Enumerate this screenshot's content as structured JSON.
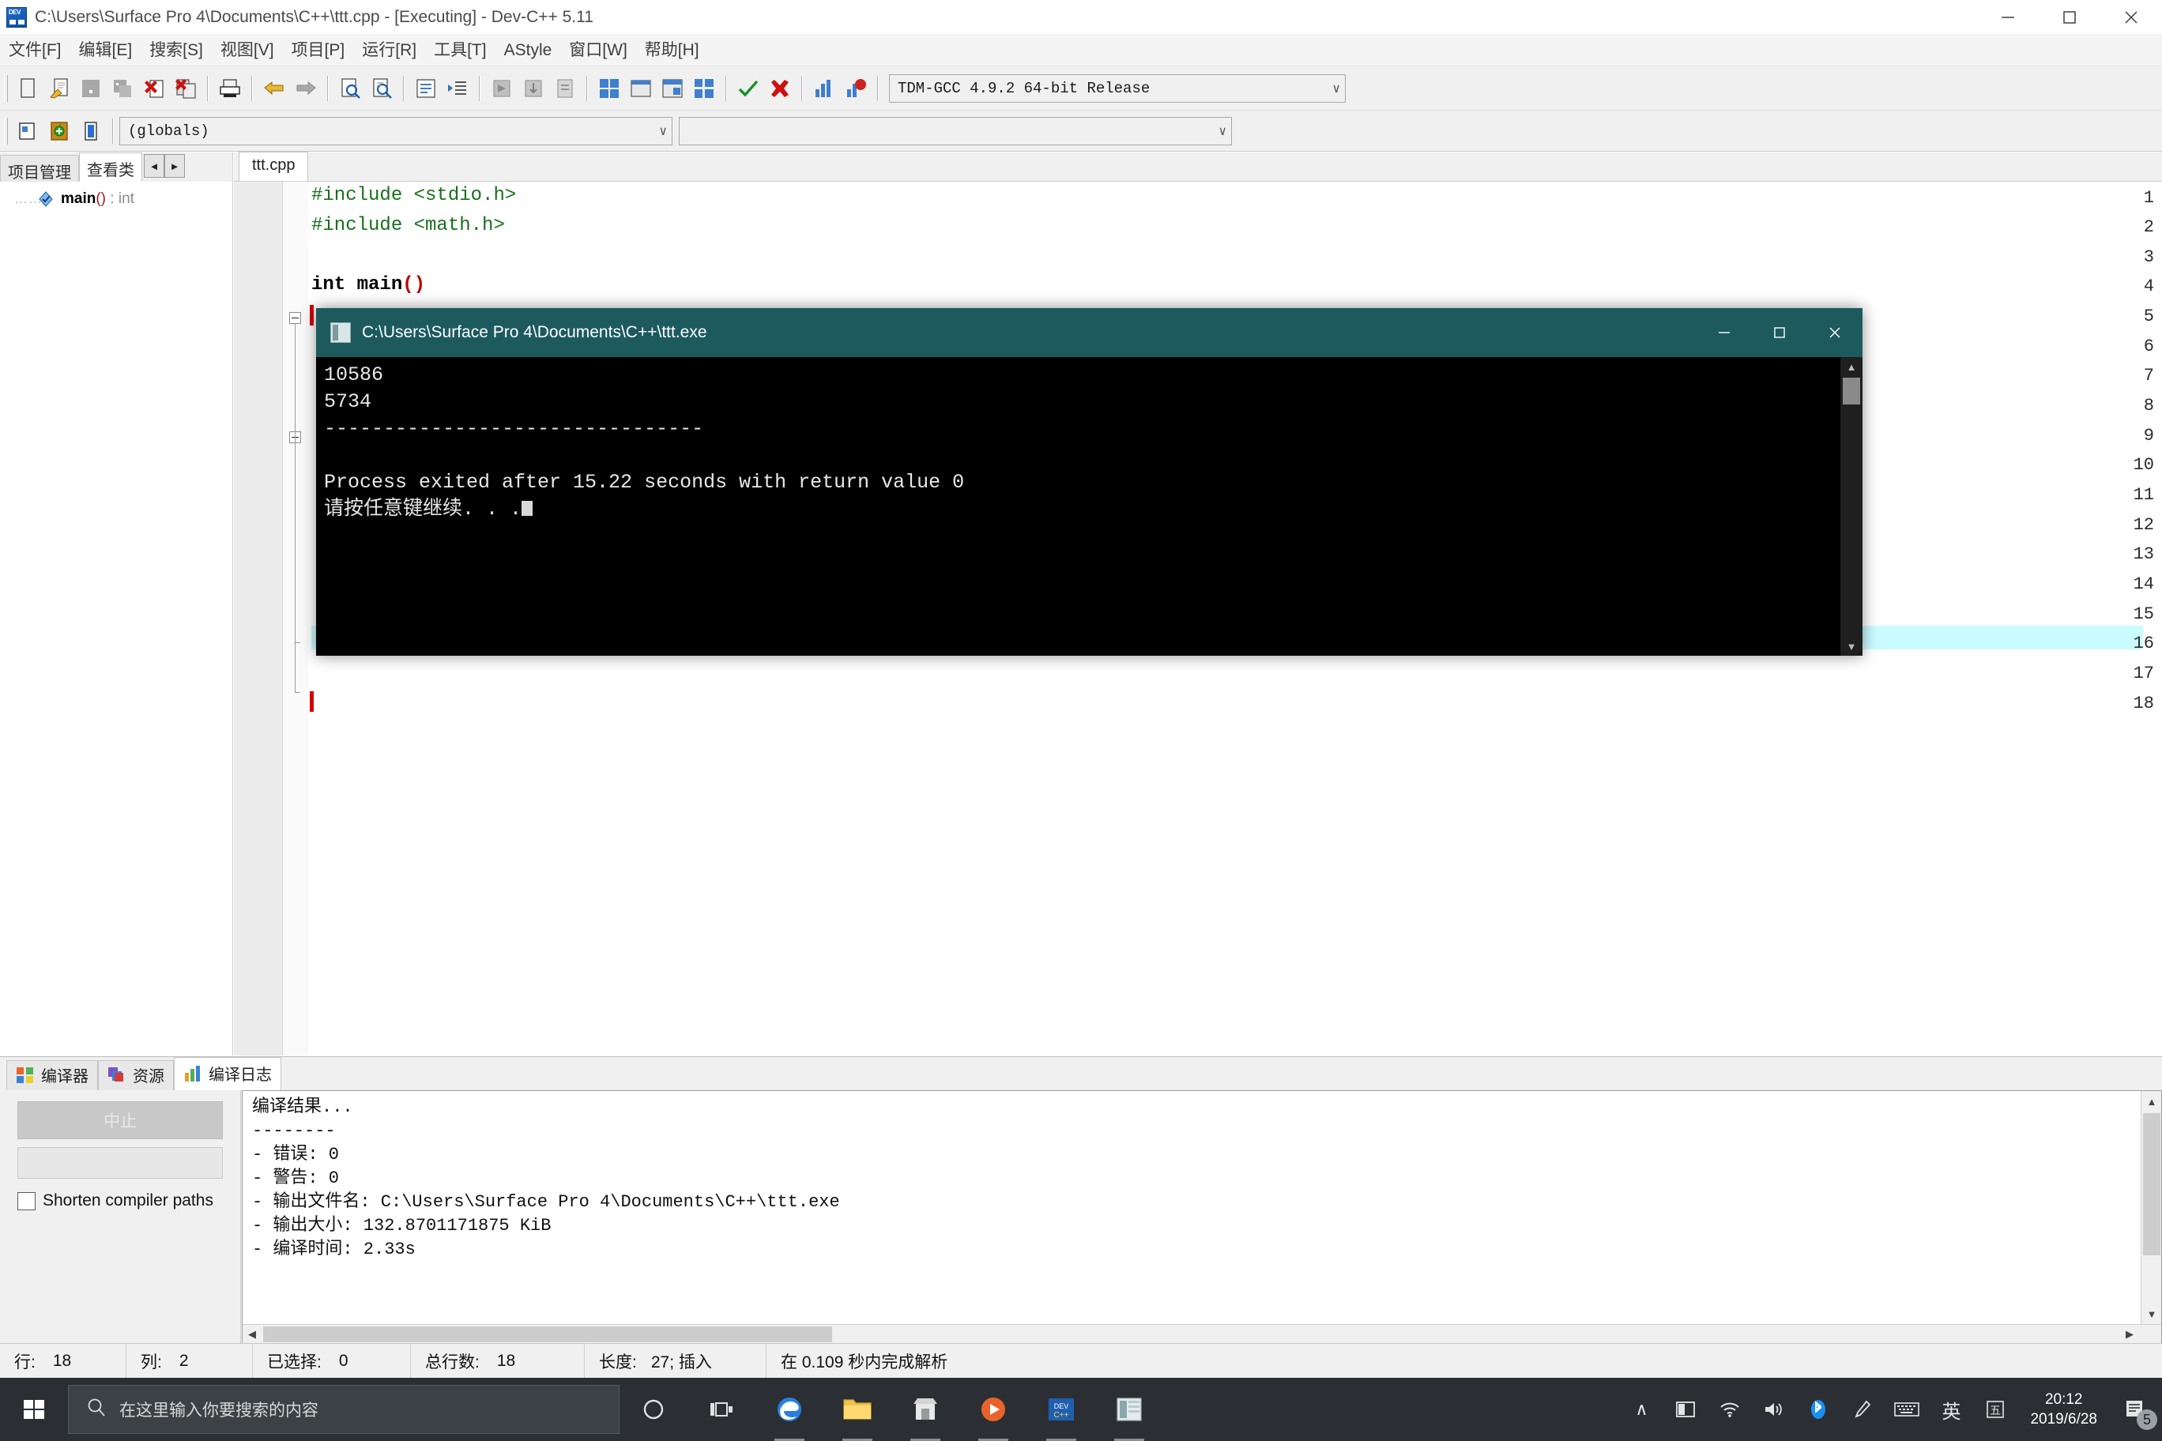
{
  "window": {
    "title": "C:\\Users\\Surface Pro 4\\Documents\\C++\\ttt.cpp - [Executing] - Dev-C++ 5.11",
    "app_icon": "devcpp-icon",
    "minimize": "─",
    "maximize": "☐",
    "close": "✕"
  },
  "menu": {
    "items": [
      {
        "label": "文件[F]",
        "name": "menu-file"
      },
      {
        "label": "编辑[E]",
        "name": "menu-edit"
      },
      {
        "label": "搜索[S]",
        "name": "menu-search"
      },
      {
        "label": "视图[V]",
        "name": "menu-view"
      },
      {
        "label": "项目[P]",
        "name": "menu-project"
      },
      {
        "label": "运行[R]",
        "name": "menu-run"
      },
      {
        "label": "工具[T]",
        "name": "menu-tools"
      },
      {
        "label": "AStyle",
        "name": "menu-astyle"
      },
      {
        "label": "窗口[W]",
        "name": "menu-window"
      },
      {
        "label": "帮助[H]",
        "name": "menu-help"
      }
    ]
  },
  "toolbar": {
    "compiler_select": "TDM-GCC 4.9.2 64-bit Release",
    "scope_select": "(globals)",
    "member_select": "",
    "dropdown_arrow": "∨"
  },
  "left_panel": {
    "tabs": [
      {
        "label": "项目管理",
        "active": false
      },
      {
        "label": "查看类",
        "active": true
      }
    ],
    "nav_prev": "◄",
    "nav_next": "►",
    "tree": [
      {
        "dots": "……",
        "icon": "class-member-icon",
        "name": "main",
        "paren": "()",
        "sep": " : ",
        "type": "int"
      }
    ]
  },
  "editor": {
    "tab_label": "ttt.cpp",
    "lines": [
      {
        "num": "1",
        "text": "#include <stdio.h>",
        "style": "pre"
      },
      {
        "num": "2",
        "text": "#include <math.h>",
        "style": "pre"
      },
      {
        "num": "3",
        "text": "",
        "style": "plain"
      },
      {
        "num": "4",
        "text": "int main()",
        "style": "kw"
      },
      {
        "num": "5",
        "text": "",
        "style": "plain"
      },
      {
        "num": "6",
        "text": "",
        "style": "plain"
      },
      {
        "num": "7",
        "text": "",
        "style": "plain"
      },
      {
        "num": "8",
        "text": "",
        "style": "plain"
      },
      {
        "num": "9",
        "text": "",
        "style": "plain"
      },
      {
        "num": "10",
        "text": "",
        "style": "plain"
      },
      {
        "num": "11",
        "text": "",
        "style": "plain"
      },
      {
        "num": "12",
        "text": "",
        "style": "plain"
      },
      {
        "num": "13",
        "text": "",
        "style": "plain"
      },
      {
        "num": "14",
        "text": "",
        "style": "plain"
      },
      {
        "num": "15",
        "text": "",
        "style": "plain"
      },
      {
        "num": "16",
        "text": "",
        "style": "plain"
      },
      {
        "num": "17",
        "text": "",
        "style": "plain"
      },
      {
        "num": "18",
        "text": "",
        "style": "plain"
      }
    ]
  },
  "console_window": {
    "title": "C:\\Users\\Surface Pro 4\\Documents\\C++\\ttt.exe",
    "minimize": "─",
    "maximize": "☐",
    "close": "✕",
    "output": [
      "10586",
      "5734",
      "--------------------------------",
      "",
      "Process exited after 15.22 seconds with return value 0"
    ],
    "prompt": "请按任意键继续. . ."
  },
  "bottom_panel": {
    "tabs": [
      {
        "label": "编译器",
        "icon": "compiler-icon",
        "active": false
      },
      {
        "label": "资源",
        "icon": "resource-icon",
        "active": false
      },
      {
        "label": "编译日志",
        "icon": "buildlog-icon",
        "active": true
      }
    ],
    "abort_label": "中止",
    "shorten_label": "Shorten compiler paths",
    "log": [
      "编译结果...",
      "--------",
      "- 错误: 0",
      "- 警告: 0",
      "- 输出文件名: C:\\Users\\Surface Pro 4\\Documents\\C++\\ttt.exe",
      "- 输出大小: 132.8701171875 KiB",
      "- 编译时间: 2.33s"
    ]
  },
  "status_bar": {
    "cells": [
      {
        "label": "行:",
        "value": "18"
      },
      {
        "label": "列:",
        "value": "2"
      },
      {
        "label": "已选择:",
        "value": "0"
      },
      {
        "label": "总行数:",
        "value": "18"
      },
      {
        "label": "长度:",
        "value": "27; 插入"
      },
      {
        "label": "在 0.109 秒内完成解析",
        "value": ""
      }
    ]
  },
  "taskbar": {
    "start_icon": "windows-start-icon",
    "search_placeholder": "在这里输入你要搜索的内容",
    "search_icon": "search-icon",
    "cortana": "cortana-icon",
    "taskview": "task-view-icon",
    "apps": [
      {
        "name": "edge-icon",
        "running": true
      },
      {
        "name": "file-explorer-icon",
        "running": true
      },
      {
        "name": "microsoft-store-icon",
        "running": true
      },
      {
        "name": "media-player-icon",
        "running": true
      },
      {
        "name": "devcpp-icon",
        "running": true
      },
      {
        "name": "console-icon",
        "running": true,
        "active": true
      }
    ],
    "tray": {
      "chevron": "∧",
      "icons": [
        "tablet-mode-icon",
        "wifi-icon",
        "volume-icon",
        "bluetooth-icon",
        "pen-icon",
        "touch-keyboard-icon"
      ],
      "ime_lang": "英",
      "ime_mode": "五",
      "time": "20:12",
      "date": "2019/6/28",
      "notification_count": "5"
    }
  },
  "colors": {
    "console_title_bg": "#1c5a5e",
    "taskbar_bg": "#2b2f34",
    "preprocessor_green": "#16701a",
    "operator_red": "#c00000",
    "current_line_cyan": "#c9fbff",
    "accent_blue": "#3ba7ef"
  }
}
